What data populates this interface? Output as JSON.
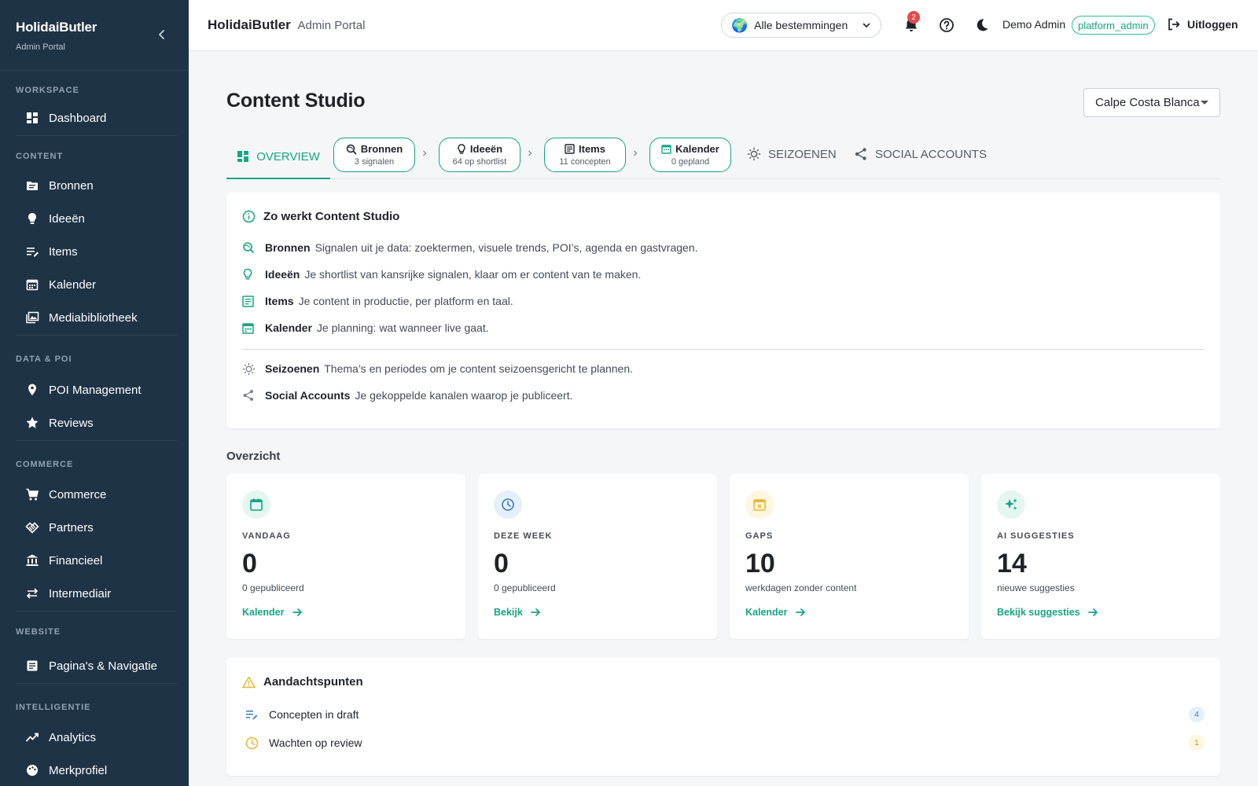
{
  "sidebar": {
    "brand_title": "HolidaiButler",
    "brand_sub": "Admin Portal",
    "sections": {
      "workspace": "WORKSPACE",
      "content": "CONTENT",
      "data_poi": "DATA & POI",
      "commerce": "COMMERCE",
      "website": "WEBSITE",
      "intelligence": "INTELLIGENTIE"
    },
    "items": {
      "dashboard": "Dashboard",
      "bronnen": "Bronnen",
      "ideeen": "Ideeën",
      "items": "Items",
      "kalender": "Kalender",
      "media": "Mediabibliotheek",
      "poi": "POI Management",
      "reviews": "Reviews",
      "commerce": "Commerce",
      "partners": "Partners",
      "financieel": "Financieel",
      "intermediair": "Intermediair",
      "paginas": "Pagina's & Navigatie",
      "analytics": "Analytics",
      "merkprofiel": "Merkprofiel"
    }
  },
  "topbar": {
    "title_bold": "HolidaiButler",
    "title_light": "Admin Portal",
    "destination": "Alle bestemmingen",
    "globe": "🌍",
    "notification_count": "2",
    "user_name": "Demo Admin",
    "role": "platform_admin",
    "logout": "Uitloggen"
  },
  "page": {
    "title": "Content Studio",
    "region": "Calpe Costa Blanca"
  },
  "tabs": {
    "overview": "OVERVIEW",
    "pills": [
      {
        "label": "Bronnen",
        "sub": "3 signalen"
      },
      {
        "label": "Ideeën",
        "sub": "64 op shortlist"
      },
      {
        "label": "Items",
        "sub": "11 concepten"
      },
      {
        "label": "Kalender",
        "sub": "0 gepland"
      }
    ],
    "seizoenen": "SEIZOENEN",
    "social": "SOCIAL ACCOUNTS"
  },
  "info": {
    "title": "Zo werkt Content Studio",
    "rows": [
      {
        "title": "Bronnen",
        "desc": "Signalen uit je data: zoektermen, visuele trends, POI’s, agenda en gastvragen."
      },
      {
        "title": "Ideeën",
        "desc": "Je shortlist van kansrijke signalen, klaar om er content van te maken."
      },
      {
        "title": "Items",
        "desc": "Je content in productie, per platform en taal."
      },
      {
        "title": "Kalender",
        "desc": "Je planning: wat wanneer live gaat."
      },
      {
        "title": "Seizoenen",
        "desc": "Thema’s en periodes om je content seizoensgericht te plannen."
      },
      {
        "title": "Social Accounts",
        "desc": "Je gekoppelde kanalen waarop je publiceert."
      }
    ]
  },
  "overview": {
    "label": "Overzicht",
    "cards": [
      {
        "label": "VANDAAG",
        "value": "0",
        "desc": "0 gepubliceerd",
        "link": "Kalender"
      },
      {
        "label": "DEZE WEEK",
        "value": "0",
        "desc": "0 gepubliceerd",
        "link": "Bekijk"
      },
      {
        "label": "GAPS",
        "value": "10",
        "desc": "werkdagen zonder content",
        "link": "Kalender"
      },
      {
        "label": "AI SUGGESTIES",
        "value": "14",
        "desc": "nieuwe suggesties",
        "link": "Bekijk suggesties"
      }
    ]
  },
  "attention": {
    "title": "Aandachtspunten",
    "rows": [
      {
        "label": "Concepten in draft",
        "count": "4"
      },
      {
        "label": "Wachten op review",
        "count": "1"
      }
    ]
  },
  "colors": {
    "accent": "#16a584",
    "sidebar_bg": "#1f3346",
    "warning": "#e8b931",
    "info": "#3a7bbf"
  }
}
